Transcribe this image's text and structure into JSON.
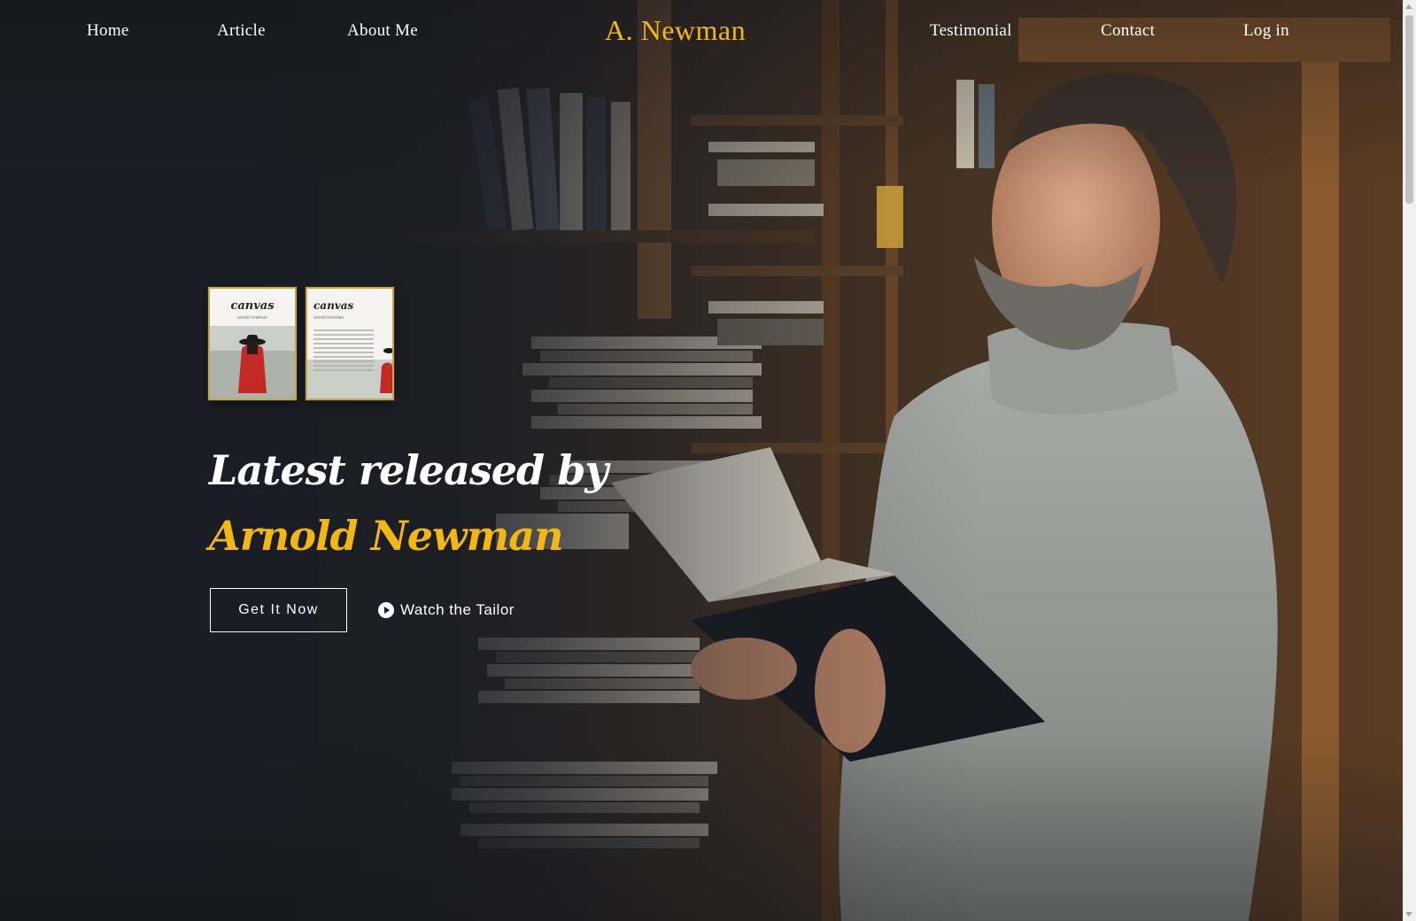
{
  "nav": {
    "items_left": [
      {
        "label": "Home"
      },
      {
        "label": "Article"
      },
      {
        "label": "About Me"
      }
    ],
    "logo": "A. Newman",
    "items_right": [
      {
        "label": "Testimonial"
      },
      {
        "label": "Contact"
      },
      {
        "label": "Log in"
      }
    ]
  },
  "hero": {
    "books": [
      {
        "title": "canvas",
        "subtitle": "arnold newman"
      },
      {
        "title": "canvas",
        "subtitle": "arnold newman"
      }
    ],
    "headline_line1": "Latest released by",
    "headline_line2": "Arnold Newman",
    "cta_primary": "Get It Now",
    "cta_secondary": "Watch the Tailor"
  },
  "colors": {
    "accent": "#f2b617",
    "background": "#1a1d25",
    "text": "#ffffff"
  },
  "icons": {
    "cta_secondary": "play-circle-icon"
  }
}
